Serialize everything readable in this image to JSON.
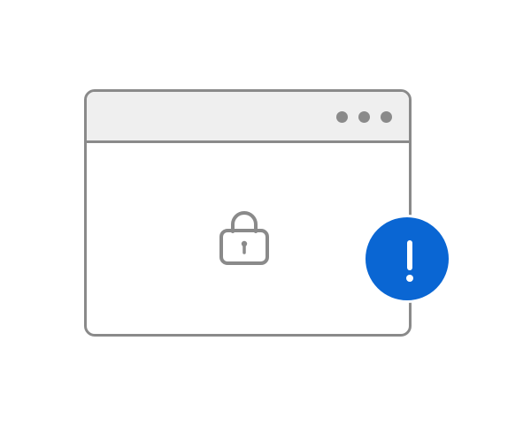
{
  "illustration": {
    "window_icon": "browser-window-icon",
    "content_icon": "lock-icon",
    "badge_icon": "exclamation-icon",
    "colors": {
      "outline": "#8a8a8a",
      "titlebar": "#efefef",
      "badge": "#0a66d3",
      "background": "#ffffff"
    }
  }
}
